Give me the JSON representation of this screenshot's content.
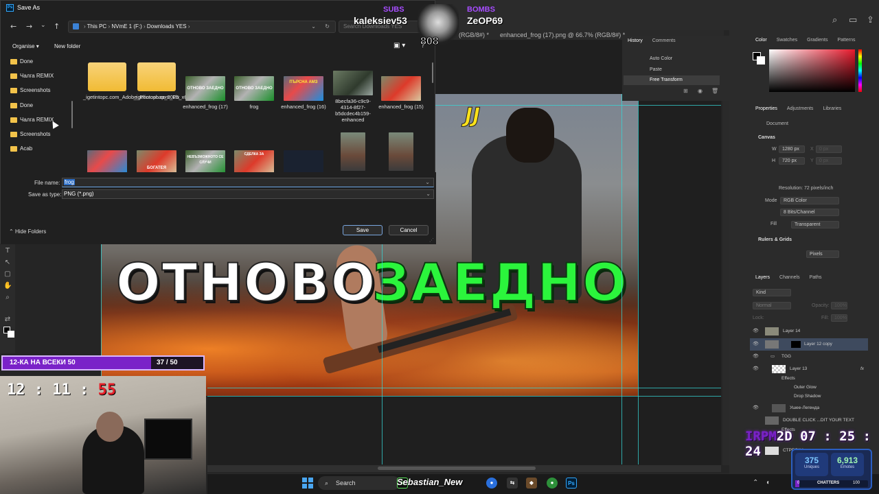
{
  "dialog": {
    "title": "Save As",
    "app_badge": "Ps",
    "address": {
      "segments": [
        "This PC",
        "NVmE 1 (F:)",
        "Downloads YES"
      ]
    },
    "search_placeholder": "Search Downloads YES",
    "toolbar": {
      "organise": "Organise",
      "new_folder": "New folder"
    },
    "nav_items": [
      "Done",
      "Чалга REMIX",
      "Screenshots",
      "Done",
      "Чалга REMIX",
      "Screenshots",
      "Acab"
    ],
    "files_row1": [
      {
        "name": "_igetintopc.com_Adobe_Photoshop_2025_x64",
        "kind": "folder"
      },
      {
        "name": "_igetintopc.com_Fix",
        "kind": "folder"
      },
      {
        "name": "enhanced_frog (17)",
        "kind": "img1",
        "overlay": "ОТНОВО ЗАЕДНО"
      },
      {
        "name": "frog",
        "kind": "img1",
        "overlay": "ОТНОВО ЗАЕДНО"
      },
      {
        "name": "enhanced_frog (16)",
        "kind": "img2",
        "overlay": "ПЪРСНА АМЗ"
      },
      {
        "name": "8becfa36-c9c9-4314-8f27-b5dcdec4b159-enhanced",
        "kind": "img3",
        "overlay": ""
      },
      {
        "name": "enhanced_frog (15)",
        "kind": "img4",
        "overlay": ""
      }
    ],
    "files_row2_overlays": [
      "",
      "БОГАТЕЯ",
      "НЕВЪЗМОЖНОТО СЕ СЛУЧИ",
      "СДЕЛКА ЗА",
      "",
      "",
      ""
    ],
    "file_name_label": "File name:",
    "file_name_value": "frog",
    "save_as_type_label": "Save as type:",
    "save_as_type_value": "PNG (*.png)",
    "hide_folders": "Hide Folders",
    "save": "Save",
    "cancel": "Cancel"
  },
  "photoshop": {
    "tabs": [
      "(RGB/8#) *",
      "enhanced_frog (17).png @ 66.7% (RGB/8#) *"
    ],
    "history": {
      "tabs": [
        "History",
        "Comments"
      ],
      "items": [
        "Auto Color",
        "Paste",
        "Free Transform"
      ]
    },
    "color_tabs": [
      "Color",
      "Swatches",
      "Gradients",
      "Patterns"
    ],
    "properties": {
      "tabs": [
        "Properties",
        "Adjustments",
        "Libraries"
      ],
      "document_label": "Document",
      "canvas_label": "Canvas",
      "w_label": "W",
      "w_value": "1280 px",
      "h_label": "H",
      "h_value": "720 px",
      "x_label": "X",
      "x_value": "0 px",
      "y_label": "Y",
      "y_value": "0 px",
      "resolution": "Resolution: 72 pixels/inch",
      "mode_label": "Mode",
      "mode_value": "RGB Color",
      "bits_value": "8 Bits/Channel",
      "fill_label": "Fill",
      "fill_value": "Transparent",
      "rulers_label": "Rulers & Grids",
      "units_value": "Pixels"
    },
    "layers": {
      "tabs": [
        "Layers",
        "Channels",
        "Paths"
      ],
      "filter": "Kind",
      "blend": "Normal",
      "opacity_label": "Opacity:",
      "opacity_value": "100%",
      "lock_label": "Lock:",
      "fill_label": "Fill:",
      "fill_value": "100%",
      "rows": [
        "Layer 14",
        "Layer 12 copy",
        "TGG",
        "Layer 13",
        "Effects",
        "Outer Glow",
        "Drop Shadow",
        "Ушее-Легенда",
        "DOUBLE CLICK ...DIT YOUR TEXT",
        "Effects",
        "СТРЕЛКИ"
      ]
    },
    "thumbnail": {
      "title_white": "ОТНОВО",
      "title_green": "ЗАЕДНО",
      "logo": "JJ"
    }
  },
  "overlay": {
    "subs_label": "SUBS",
    "subs_name": "kaleksiev53",
    "bombs_label": "BOMBS",
    "bombs_name": "ZeOP69",
    "skull_text": "808",
    "goal": {
      "label": "12-КА НА ВСЕКИ 50",
      "count": "37 / 50",
      "progress": 0.74
    },
    "clock": {
      "hm": "12 : 11 :",
      "sec": "55"
    },
    "rpm": {
      "prefix": "IRPM",
      "value": "2D 07 : 25 : 24"
    },
    "stats": {
      "uniques_value": "375",
      "uniques_label": "Uniques",
      "emotes_value": "6,913",
      "emotes_label": "Emotes",
      "chatters_label": "CHATTERS",
      "chatters_min": "0",
      "chatters_max": "100"
    },
    "streamer": "Sebastian_New"
  },
  "taskbar": {
    "search": "Search"
  },
  "colors": {
    "accent_purple": "#7a22c8",
    "green_title": "#2bf53c",
    "save_border": "#7aa7e0"
  }
}
